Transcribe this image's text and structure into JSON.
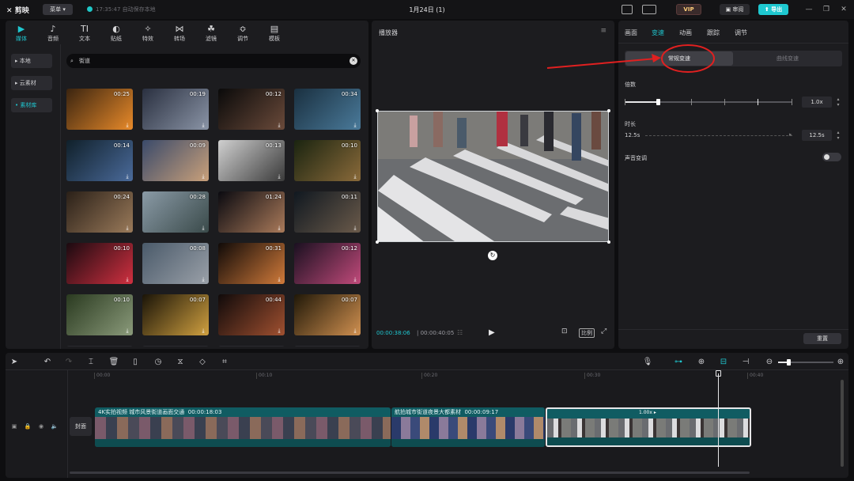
{
  "titlebar": {
    "logo": "剪映",
    "menu": "菜单 ▾",
    "autosave": "17:35:47 自动保存本地",
    "title": "1月24日 (1)",
    "vip": "VIP",
    "review": "审阅",
    "export": "导出"
  },
  "media": {
    "tools": [
      {
        "icon": "▶",
        "label": "媒体"
      },
      {
        "icon": "♪",
        "label": "音频"
      },
      {
        "icon": "TI",
        "label": "文本"
      },
      {
        "icon": "◐",
        "label": "贴纸"
      },
      {
        "icon": "✧",
        "label": "特效"
      },
      {
        "icon": "⋈",
        "label": "转场"
      },
      {
        "icon": "☘",
        "label": "滤镜"
      },
      {
        "icon": "≎",
        "label": "调节"
      },
      {
        "icon": "▤",
        "label": "模板"
      }
    ],
    "sidebar": [
      "本地",
      "云素材",
      "素材库"
    ],
    "search": {
      "value": "街道"
    },
    "thumbs": [
      {
        "dur": "00:25",
        "c1": "#3a2410",
        "c2": "#e88a2a"
      },
      {
        "dur": "00:19",
        "c1": "#2a3040",
        "c2": "#8a94a6"
      },
      {
        "dur": "00:12",
        "c1": "#0a0a0a",
        "c2": "#6a4a3a"
      },
      {
        "dur": "00:34",
        "c1": "#1a3040",
        "c2": "#4a7a9a"
      },
      {
        "dur": "00:14",
        "c1": "#10202a",
        "c2": "#4a6a9a"
      },
      {
        "dur": "00:09",
        "c1": "#3a4a6a",
        "c2": "#c9a07a"
      },
      {
        "dur": "00:13",
        "c1": "#d0d0d0",
        "c2": "#3a3a3a"
      },
      {
        "dur": "00:10",
        "c1": "#1a2410",
        "c2": "#8a6a3a"
      },
      {
        "dur": "00:24",
        "c1": "#2a2018",
        "c2": "#9a7a5a"
      },
      {
        "dur": "00:28",
        "c1": "#8a9aa6",
        "c2": "#3a4a4a"
      },
      {
        "dur": "01:24",
        "c1": "#0a0a10",
        "c2": "#aa7a5a"
      },
      {
        "dur": "00:11",
        "c1": "#101820",
        "c2": "#6a5a4a"
      },
      {
        "dur": "00:10",
        "c1": "#1a0a10",
        "c2": "#d03040"
      },
      {
        "dur": "00:08",
        "c1": "#4a5a6a",
        "c2": "#9aa0a8"
      },
      {
        "dur": "00:31",
        "c1": "#100a08",
        "c2": "#d07a3a"
      },
      {
        "dur": "00:12",
        "c1": "#1a1020",
        "c2": "#c04a7a"
      },
      {
        "dur": "00:10",
        "c1": "#2a3a20",
        "c2": "#8a9a7a"
      },
      {
        "dur": "00:07",
        "c1": "#1a1408",
        "c2": "#d0a040"
      },
      {
        "dur": "00:44",
        "c1": "#100a0a",
        "c2": "#a05030"
      },
      {
        "dur": "00:07",
        "c1": "#201808",
        "c2": "#d09050"
      }
    ]
  },
  "player": {
    "title": "播放器",
    "current_time": "00:00:38:06",
    "total_time": "00:00:40:05",
    "ratio": "比例"
  },
  "props": {
    "tabs": [
      "画面",
      "变速",
      "动画",
      "跟踪",
      "调节"
    ],
    "active_tab": "变速",
    "modes": [
      "常规变速",
      "曲线变速"
    ],
    "speed_label": "倍数",
    "speed_value": "1.0x",
    "duration_label": "时长",
    "duration_from": "12.5s",
    "duration_to": "12.5s",
    "pitch_label": "声音变调",
    "reset": "重置"
  },
  "timeline": {
    "ticks": [
      "00:00",
      "00:10",
      "00:20",
      "00:30",
      "00:40"
    ],
    "cover": "封面",
    "clips": [
      {
        "label": "4K实拍视频 城市风景街道画面交通",
        "dur": "00:00:18:03"
      },
      {
        "label": "航拍城市街道夜景大都素材",
        "dur": "00:00:09:17"
      },
      {
        "label": "",
        "dur": "",
        "speed": "1.00x ▸"
      }
    ]
  },
  "colors": {
    "accent": "#1fc7d0",
    "annotation": "#e02020"
  }
}
